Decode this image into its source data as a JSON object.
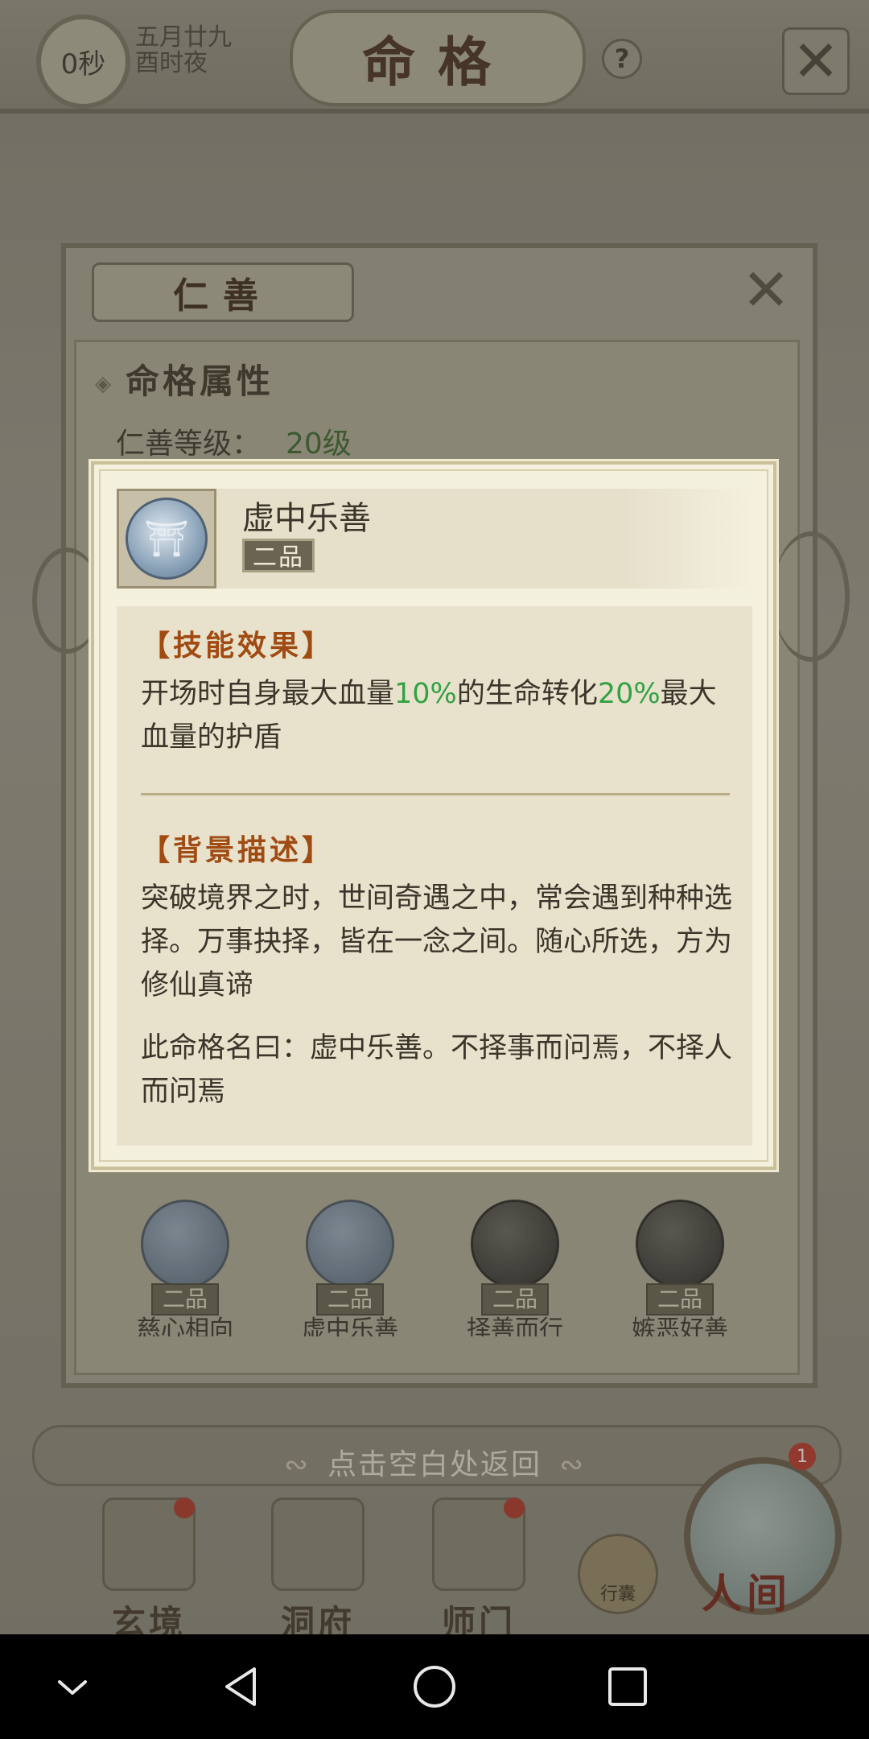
{
  "topbar": {
    "timer": "0秒",
    "date_line1": "五月廿九",
    "date_line2": "酉时夜",
    "title": "命格",
    "help": "?"
  },
  "panel": {
    "title": "仁善",
    "section_title": "命格属性",
    "level_label": "仁善等级：",
    "level_value": "20级"
  },
  "talents": [
    {
      "grade": "二品",
      "name": "慈心相向",
      "icon": "heart-orb-icon"
    },
    {
      "grade": "二品",
      "name": "虚中乐善",
      "icon": "cauldron-orb-icon"
    },
    {
      "grade": "二品",
      "name": "择善而行",
      "icon": "eye-orb-icon"
    },
    {
      "grade": "二品",
      "name": "嫉恶好善",
      "icon": "sphere-orb-icon"
    }
  ],
  "popup": {
    "skill_name": "虚中乐善",
    "skill_grade": "二品",
    "effect_title": "【技能效果】",
    "effect_part1": "开场时自身最大血量",
    "effect_pct1": "10%",
    "effect_part2": "的生命转化",
    "effect_pct2": "20%",
    "effect_part3": "最大血量的护盾",
    "bg_title": "【背景描述】",
    "bg_para1": "突破境界之时，世间奇遇之中，常会遇到种种选择。万事抉择，皆在一念之间。随心所选，方为修仙真谛",
    "bg_para2": "此命格名曰：虚中乐善。不择事而问焉，不择人而问焉",
    "highlight_color": "#33a144",
    "title_color": "#a04b12"
  },
  "back_hint": "点击空白处返回",
  "bottom_nav": {
    "xuanjing": "玄境",
    "dongfu": "洞府",
    "shimen": "师门",
    "bag": "行囊",
    "renjian": "人间",
    "renjian_badge": "1"
  }
}
